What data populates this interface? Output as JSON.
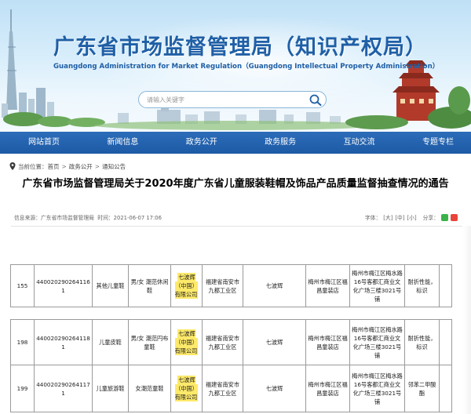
{
  "header": {
    "title_cn": "广东省市场监督管理局（知识产权局）",
    "title_en": "Guangdong Administration for Market Regulation（Guangdong Intellectual Property Administration）",
    "search_placeholder": "请输入关键字"
  },
  "nav": {
    "items": [
      "网站首页",
      "新闻信息",
      "政务公开",
      "政务服务",
      "互动交流",
      "专题专栏"
    ]
  },
  "breadcrumb": {
    "label": "当前位置：",
    "items": [
      "首页",
      "政务公开",
      "通知公告"
    ],
    "separator": ">"
  },
  "article": {
    "title": "广东省市场监督管理局关于2020年度广东省儿童服装鞋帽及饰品产品质量监督抽查情况的通告",
    "source": "信息来源：广东省市场监督管理局",
    "time": "时间：2021-06-07 17:06",
    "font_size_label": "分享：",
    "font_size_buttons": [
      "[大]",
      "[中]",
      "[小]"
    ],
    "font_label_prefix": "字体："
  },
  "table1": {
    "rows": [
      {
        "no": "155",
        "code": "4400202902641161",
        "product": "其他儿童鞋",
        "model": "男/女 潮范休闲鞋",
        "manufacturer": "七波辉（中国）有限公司",
        "mfr_address": "福建省南安市九都工业区",
        "brand": "七波辉",
        "seller": "梅州市梅江区福昌童装店",
        "seller_address": "梅州市梅江区梅水路16号客都汇商业文化广场三楼3021号铺",
        "result": "耐折性能，标识"
      }
    ]
  },
  "table2": {
    "rows": [
      {
        "no": "198",
        "code": "4400202902641181",
        "product": "儿童皮鞋",
        "model": "男/女 潮范円布童鞋",
        "manufacturer": "七波辉（中国）有限公司",
        "mfr_address": "福建省南安市九都工业区",
        "brand": "七波辉",
        "seller": "梅州市梅江区福昌童装店",
        "seller_address": "梅州市梅江区梅水路16号客都汇商业文化广场三楼3021号铺",
        "result": "耐折性能，标识"
      },
      {
        "no": "199",
        "code": "4400202902641171",
        "product": "儿童旅游鞋",
        "model": "女潮范童鞋",
        "manufacturer": "七波辉（中国）有限公司",
        "mfr_address": "福建省南安市九都工业区",
        "brand": "七波辉",
        "seller": "梅州市梅江区福昌童装店",
        "seller_address": "梅州市梅江区梅水路16号客都汇商业文化广场三楼3021号铺",
        "result": "邻苯二甲酸酯"
      }
    ]
  },
  "colors": {
    "brand_blue": "#1f5fa6",
    "nav_blue": "#1d5aa6",
    "highlight_yellow": "#fde96a"
  },
  "icons": {
    "search": "search-icon",
    "location": "location-pin-icon",
    "share": [
      "wechat-icon",
      "weibo-icon"
    ]
  }
}
